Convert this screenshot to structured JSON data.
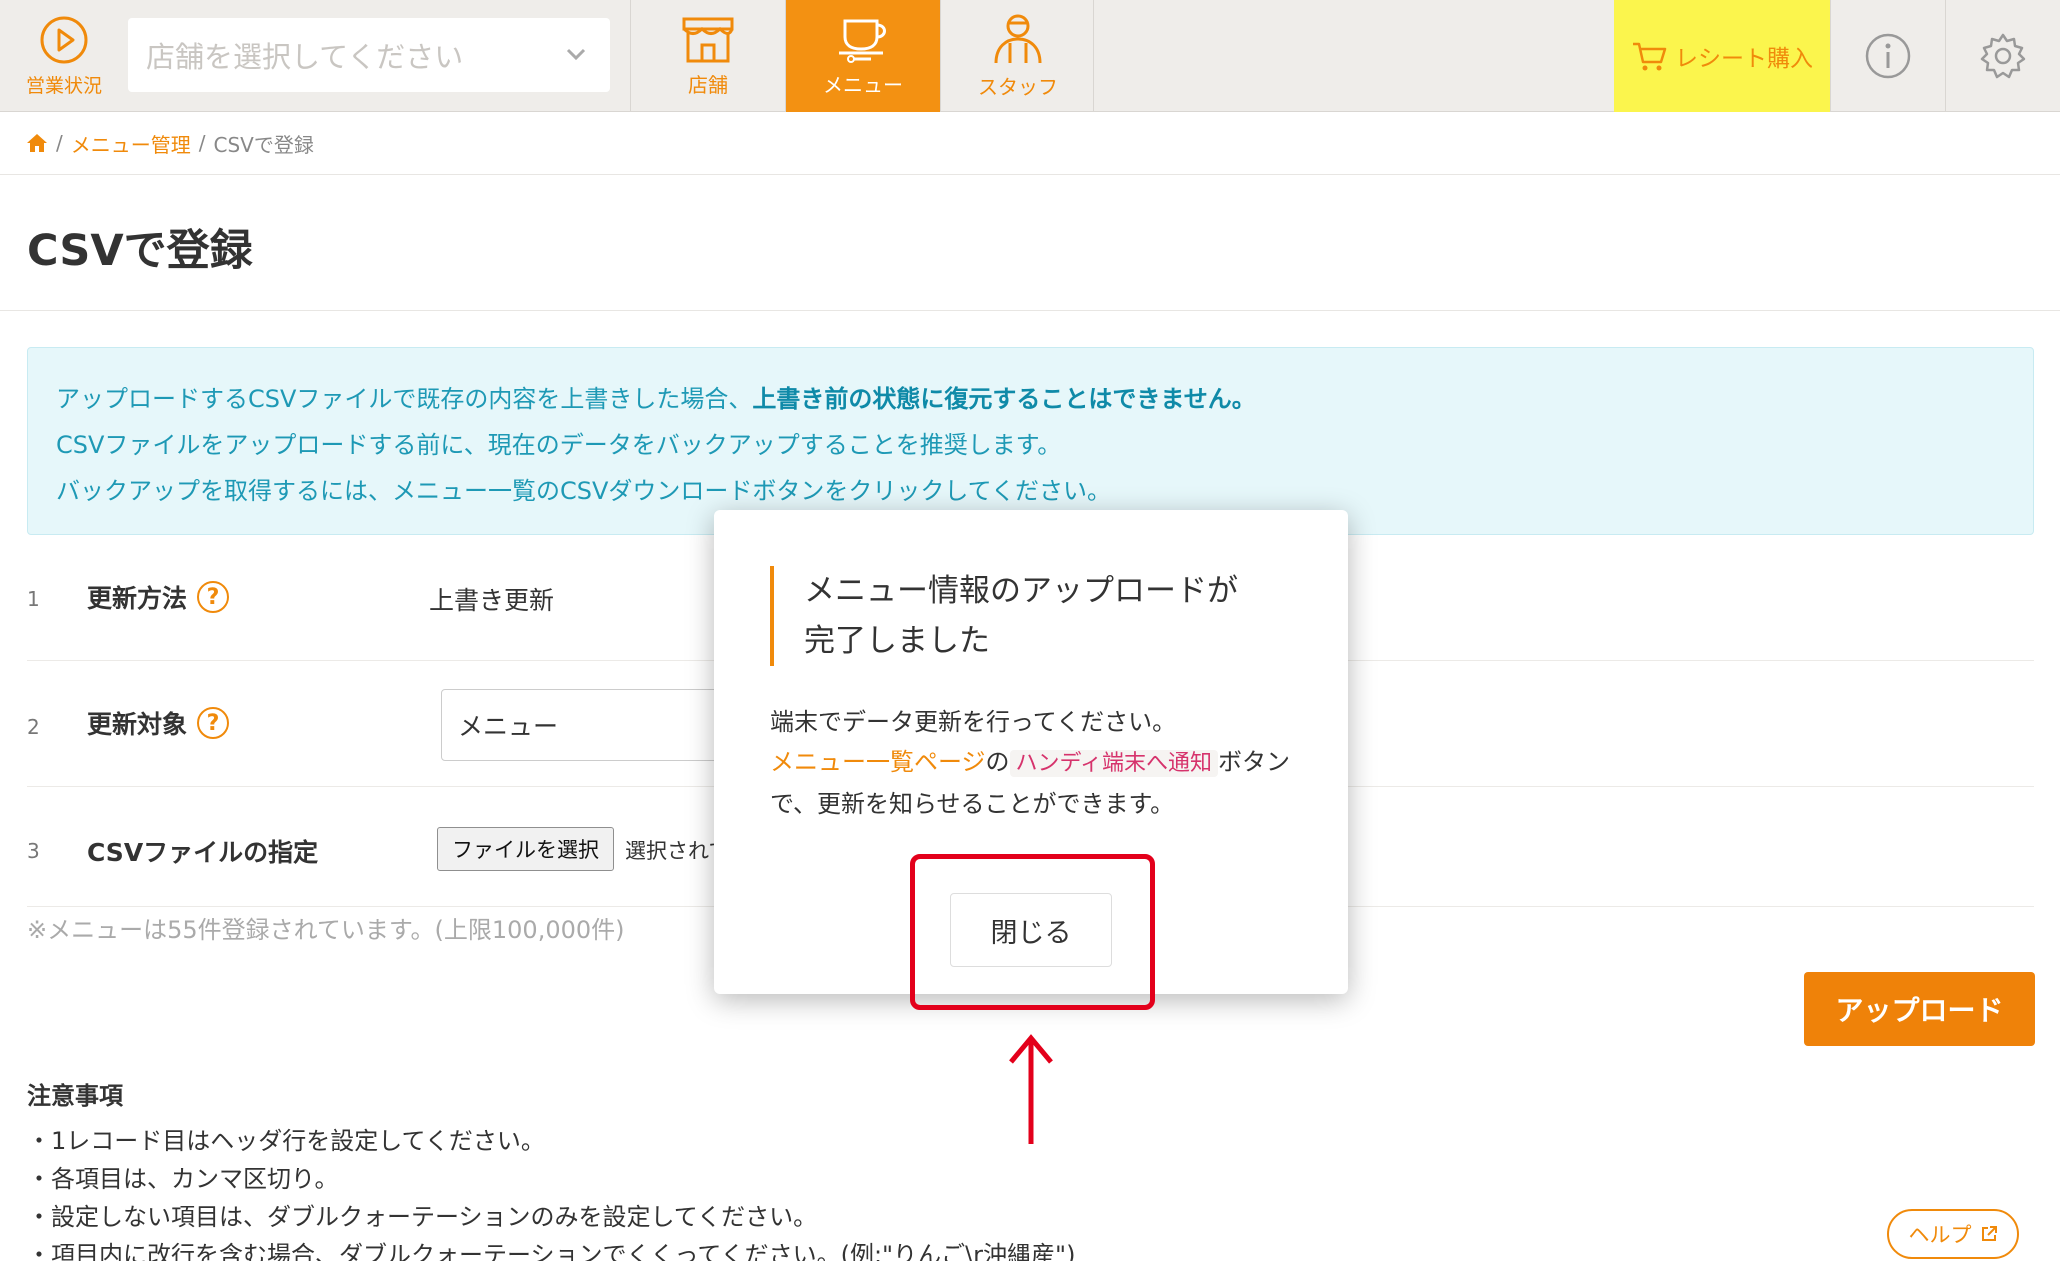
{
  "nav": {
    "status_label": "営業状況",
    "store_placeholder": "店舗を選択してください",
    "tabs": [
      {
        "label": "店舗",
        "icon": "storefront-icon"
      },
      {
        "label": "メニュー",
        "icon": "menu-tray-icon",
        "active": true
      },
      {
        "label": "スタッフ",
        "icon": "staff-icon"
      }
    ],
    "receipt_label": "レシート購入",
    "accent": "#f39112",
    "receipt_bg": "#fbf54d"
  },
  "breadcrumb": {
    "home_icon": "home-icon",
    "menu_mgmt": "メニュー管理",
    "current": "CSVで登録"
  },
  "page": {
    "title": "CSVで登録"
  },
  "alert": {
    "line1_prefix": "アップロードするCSVファイルで既存の内容を上書きした場合、",
    "line1_bold": "上書き前の状態に復元することはできません。",
    "line2": "CSVファイルをアップロードする前に、現在のデータをバックアップすることを推奨します。",
    "line3": "バックアップを取得するには、メニュー一覧のCSVダウンロードボタンをクリックしてください。"
  },
  "form": {
    "rows": [
      {
        "num": "1",
        "label": "更新方法",
        "value": "上書き更新"
      },
      {
        "num": "2",
        "label": "更新対象",
        "value": "メニュー"
      },
      {
        "num": "3",
        "label": "CSVファイルの指定",
        "file_button": "ファイルを選択",
        "file_status": "選択されていません"
      }
    ],
    "count_note": "※メニューは55件登録されています。(上限100,000件)",
    "upload_label": "アップロード"
  },
  "notes": {
    "title": "注意事項",
    "items": [
      "・1レコード目はヘッダ行を設定してください。",
      "・各項目は、カンマ区切り。",
      "・設定しない項目は、ダブルクォーテーションのみを設定してください。",
      "・項目内に改行を含む場合、ダブルクォーテーションでくくってください。(例:\"りんご\\r沖縄産\")"
    ],
    "help_label": "ヘルプ"
  },
  "modal": {
    "title_line1": "メニュー情報のアップロードが",
    "title_line2": "完了しました",
    "body_line1": "端末でデータ更新を行ってください。",
    "link_text": "メニュー一覧ページ",
    "connector": "の",
    "code_text": "ハンディ端末へ通知",
    "suffix": "ボタンで、更新を知らせることができます。",
    "close_label": "閉じる"
  }
}
